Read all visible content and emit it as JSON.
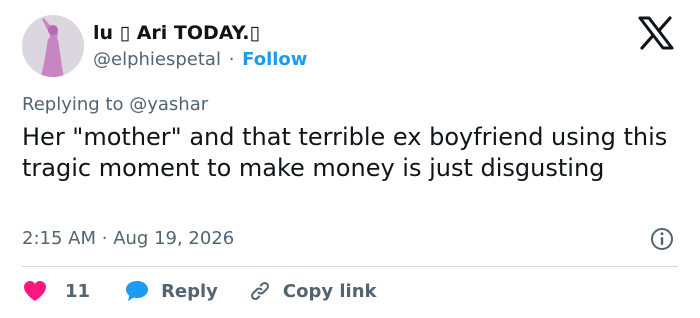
{
  "author": {
    "display_name": "lu ▯ Ari TODAY.▯",
    "handle": "@elphiespetal",
    "separator": "·",
    "follow_label": "Follow"
  },
  "reply_context": {
    "prefix": "Replying to",
    "mention": "@yashar"
  },
  "tweet": {
    "text": "Her \"mother\" and that terrible ex boyfriend using this tragic moment to make money is just disgusting",
    "time": "2:15 AM",
    "separator": "·",
    "date": "Aug 19, 2026"
  },
  "actions": {
    "like_count": "11",
    "reply_label": "Reply",
    "copy_link_label": "Copy link"
  },
  "icons": {
    "logo": "x-logo-icon",
    "info": "info-icon",
    "like": "heart-icon",
    "reply": "speech-bubble-icon",
    "copy": "link-icon"
  },
  "colors": {
    "accent": "#1d9bf0",
    "like": "#f91880",
    "text": "#0f1419",
    "muted": "#536471",
    "divider": "#cfd9de"
  }
}
